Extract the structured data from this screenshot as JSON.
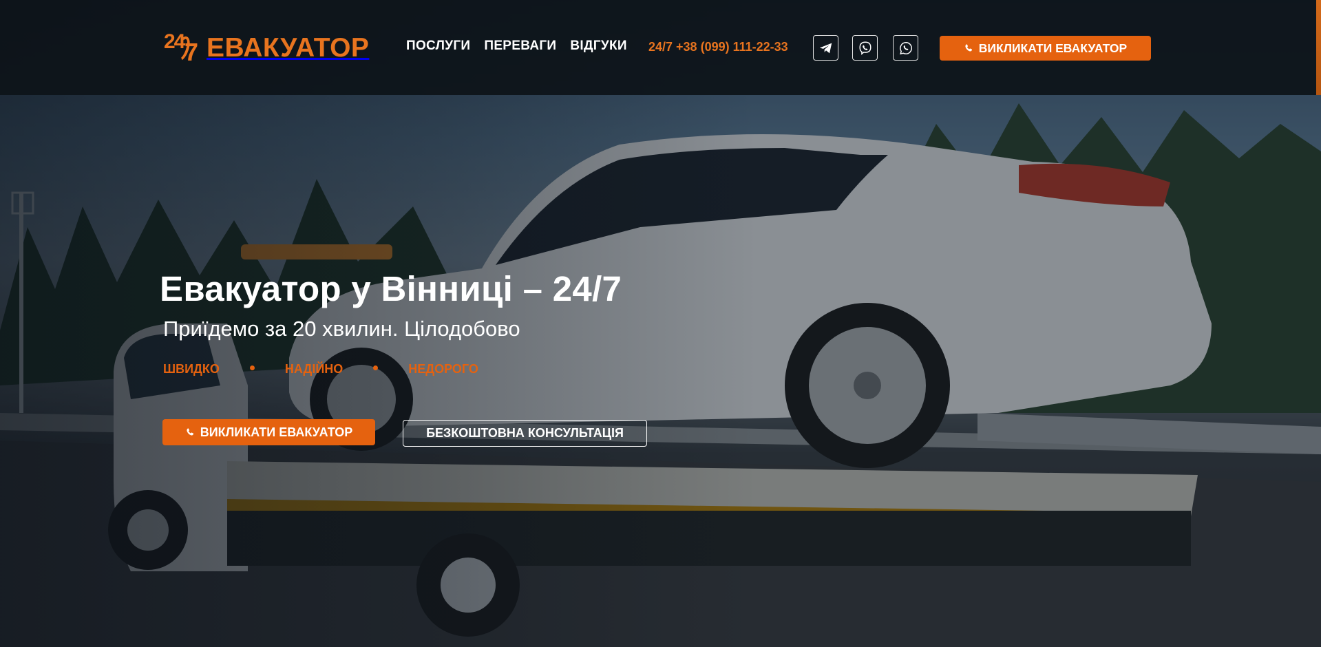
{
  "header": {
    "logo": {
      "mark": "24/7",
      "mark_left": "24",
      "mark_right": "7",
      "text": "ЕВАКУАТОР"
    },
    "nav": [
      {
        "label": "ПОСЛУГИ"
      },
      {
        "label": "ПЕРЕВАГИ"
      },
      {
        "label": "ВІДГУКИ"
      }
    ],
    "phone": "24/7 +38 (099) 111-22-33",
    "social": [
      {
        "name": "telegram-icon"
      },
      {
        "name": "viber-icon"
      },
      {
        "name": "whatsapp-icon"
      }
    ],
    "cta_label": "ВИКЛИКАТИ ЕВАКУАТОР"
  },
  "hero": {
    "title": "Евакуатор у Вінниці – 24/7",
    "subtitle": "Приїдемо за 20 хвилин. Цілодобово",
    "features": [
      "ШВИДКО",
      "НАДІЙНО",
      "НЕДОРОГО"
    ],
    "cta_label": "ВИКЛИКАТИ ЕВАКУАТОР",
    "consult_label": "БЕЗКОШТОВНА КОНСУЛЬТАЦІЯ"
  },
  "colors": {
    "accent": "#e5620f",
    "header_bg": "#0d1319",
    "text": "#ffffff"
  }
}
